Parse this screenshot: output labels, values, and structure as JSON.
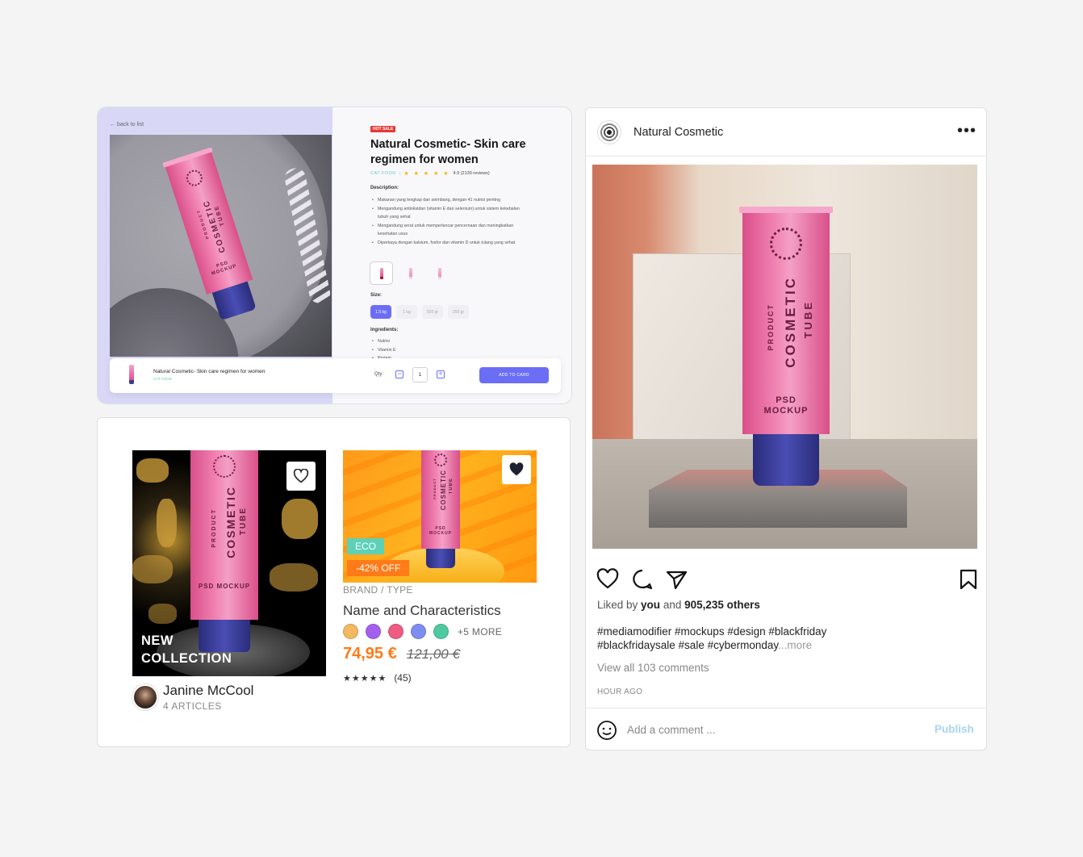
{
  "product_page": {
    "back_link": "back to list",
    "badge": "HOT SALE",
    "title": "Natural Cosmetic- Skin care regimen for women",
    "category": "CAT FOOD",
    "stars": "★ ★ ★ ★ ★",
    "rating": "4.9 (2130 reviews)",
    "description_label": "Description:",
    "description_items": [
      "Makanan yang lengkap dan seimbang, dengan 41 nutrisi penting",
      "Mengandung antioksidan (vitamin E dan selenium) untuk sistem kekebalan tubuh yang sehat",
      "Mengandung serat untuk memperlancar pencernaan dan meningkatkan kesehatan usus",
      "Diperkaya dengan kalsium, fosfor dan vitamin D untuk tulang yang sehat"
    ],
    "size_label": "Size:",
    "sizes": [
      "1.5 kg",
      "1 kg",
      "500 gr",
      "250 gr"
    ],
    "selected_size": 0,
    "ingredients_label": "Ingredients:",
    "ingredients": [
      "Nutrisi",
      "Vitamin E",
      "Protein"
    ],
    "cart": {
      "name": "Natural Cosmetic- Skin care regimen for women",
      "category": "CAT FOOD",
      "qty_label": "Qty:",
      "qty": "1",
      "minus": "−",
      "plus": "+",
      "button": "ADD TO CARD"
    },
    "tube": {
      "brand": "COSMETIC",
      "line1": "PRODUCT",
      "line2": "TUBE",
      "psd": "PSD MOCKUP"
    }
  },
  "collection_card": {
    "badge_line1": "NEW",
    "badge_line2": "COLLECTION",
    "author_name": "Janine McCool",
    "author_articles": "4 ARTICLES"
  },
  "item_card": {
    "eco_badge": "ECO",
    "discount_badge": "-42% OFF",
    "brand_type": "BRAND / TYPE",
    "name": "Name and Characteristics",
    "swatch_colors": [
      "#f4b860",
      "#a55ff0",
      "#ee5b83",
      "#7f8cf0",
      "#4fc9a0"
    ],
    "more_colors": "+5 MORE",
    "price": "74,95 €",
    "old_price": "121,00 €",
    "review_stars": "★★★★★",
    "review_count": "(45)"
  },
  "social_post": {
    "account_name": "Natural Cosmetic",
    "menu": "•••",
    "likes_prefix": "Liked by ",
    "likes_you": "you",
    "likes_and": " and ",
    "likes_count": "905,235 others",
    "caption": "#mediamodifier #mockups #design #blackfriday #blackfridaysale #sale #cybermonday",
    "caption_more": "...more",
    "view_comments": "View all 103 comments",
    "time_ago": "HOUR AGO",
    "comment_placeholder": "Add a comment ...",
    "publish": "Publish"
  },
  "colors": {
    "accent": "#6b6ef5",
    "orange": "#ff7a18",
    "eco": "#5dd0b8",
    "hot": "#e53935"
  }
}
